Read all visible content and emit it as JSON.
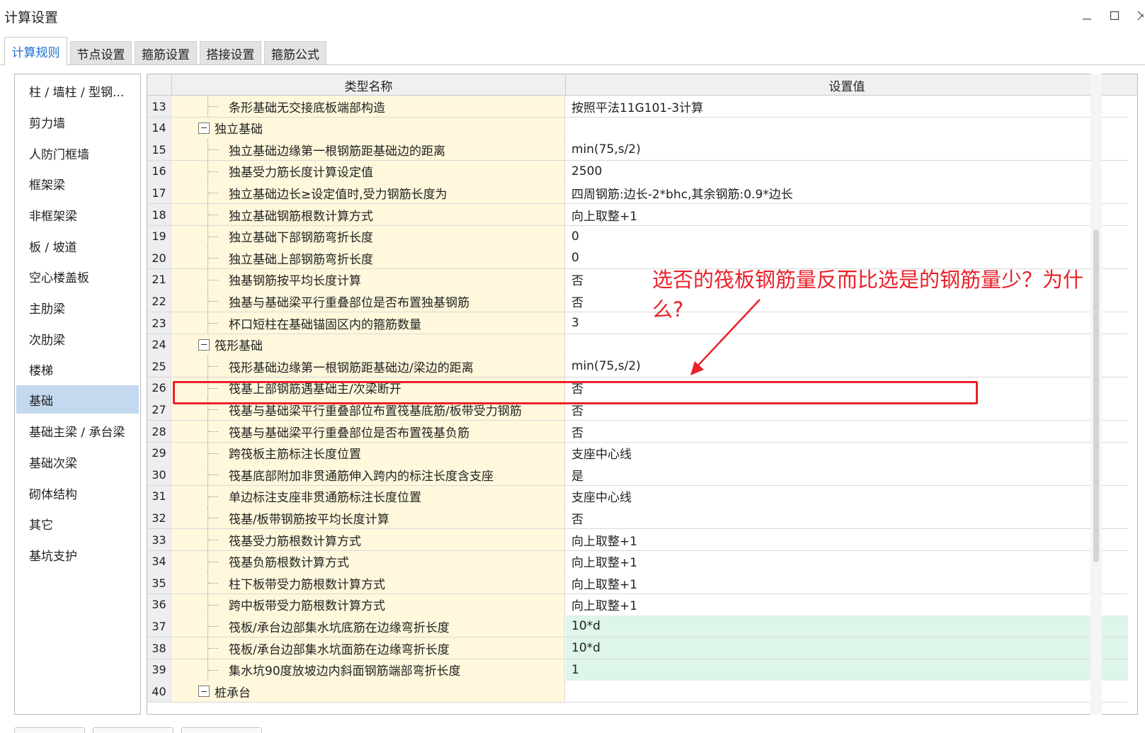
{
  "window": {
    "title": "计算设置",
    "minimize": "—",
    "maximize": "☐",
    "close": "›"
  },
  "tabs": [
    {
      "label": "计算规则",
      "active": true
    },
    {
      "label": "节点设置",
      "active": false
    },
    {
      "label": "箍筋设置",
      "active": false
    },
    {
      "label": "搭接设置",
      "active": false
    },
    {
      "label": "箍筋公式",
      "active": false
    }
  ],
  "sidebar": {
    "items": [
      {
        "label": "柱 / 墙柱 / 型钢..."
      },
      {
        "label": "剪力墙"
      },
      {
        "label": "人防门框墙"
      },
      {
        "label": "框架梁"
      },
      {
        "label": "非框架梁"
      },
      {
        "label": "板 / 坡道"
      },
      {
        "label": "空心楼盖板"
      },
      {
        "label": "主肋梁"
      },
      {
        "label": "次肋梁"
      },
      {
        "label": "楼梯"
      },
      {
        "label": "基础",
        "selected": true
      },
      {
        "label": "基础主梁 / 承台梁"
      },
      {
        "label": "基础次梁"
      },
      {
        "label": "砌体结构"
      },
      {
        "label": "其它"
      },
      {
        "label": "基坑支护"
      }
    ]
  },
  "grid": {
    "headers": {
      "name": "类型名称",
      "value": "设置值"
    },
    "rows": [
      {
        "num": "13",
        "name": "条形基础无交接底板端部构造",
        "value": "按照平法11G101-3计算"
      },
      {
        "num": "14",
        "name": "独立基础",
        "value": "",
        "group": true
      },
      {
        "num": "15",
        "name": "独立基础边缘第一根钢筋距基础边的距离",
        "value": "min(75,s/2)"
      },
      {
        "num": "16",
        "name": "独基受力筋长度计算设定值",
        "value": "2500"
      },
      {
        "num": "17",
        "name": "独立基础边长≥设定值时,受力钢筋长度为",
        "value": "四周钢筋:边长-2*bhc,其余钢筋:0.9*边长"
      },
      {
        "num": "18",
        "name": "独立基础钢筋根数计算方式",
        "value": "向上取整+1"
      },
      {
        "num": "19",
        "name": "独立基础下部钢筋弯折长度",
        "value": "0"
      },
      {
        "num": "20",
        "name": "独立基础上部钢筋弯折长度",
        "value": "0"
      },
      {
        "num": "21",
        "name": "独基钢筋按平均长度计算",
        "value": "否"
      },
      {
        "num": "22",
        "name": "独基与基础梁平行重叠部位是否布置独基钢筋",
        "value": "否"
      },
      {
        "num": "23",
        "name": "杯口短柱在基础锚固区内的箍筋数量",
        "value": "3"
      },
      {
        "num": "24",
        "name": "筏形基础",
        "value": "",
        "group": true
      },
      {
        "num": "25",
        "name": "筏形基础边缘第一根钢筋距基础边/梁边的距离",
        "value": "min(75,s/2)"
      },
      {
        "num": "26",
        "name": "筏基上部钢筋遇基础主/次梁断开",
        "value": "否"
      },
      {
        "num": "27",
        "name": "筏基与基础梁平行重叠部位布置筏基底筋/板带受力钢筋",
        "value": "否"
      },
      {
        "num": "28",
        "name": "筏基与基础梁平行重叠部位是否布置筏基负筋",
        "value": "否"
      },
      {
        "num": "29",
        "name": "跨筏板主筋标注长度位置",
        "value": "支座中心线"
      },
      {
        "num": "30",
        "name": "筏基底部附加非贯通筋伸入跨内的标注长度含支座",
        "value": "是"
      },
      {
        "num": "31",
        "name": "单边标注支座非贯通筋标注长度位置",
        "value": "支座中心线"
      },
      {
        "num": "32",
        "name": "筏基/板带钢筋按平均长度计算",
        "value": "否"
      },
      {
        "num": "33",
        "name": "筏基受力筋根数计算方式",
        "value": "向上取整+1"
      },
      {
        "num": "34",
        "name": "筏基负筋根数计算方式",
        "value": "向上取整+1"
      },
      {
        "num": "35",
        "name": "柱下板带受力筋根数计算方式",
        "value": "向上取整+1"
      },
      {
        "num": "36",
        "name": "跨中板带受力筋根数计算方式",
        "value": "向上取整+1"
      },
      {
        "num": "37",
        "name": "筏板/承台边部集水坑底筋在边缘弯折长度",
        "value": "10*d",
        "green": true
      },
      {
        "num": "38",
        "name": "筏板/承台边部集水坑面筋在边缘弯折长度",
        "value": "10*d",
        "green": true
      },
      {
        "num": "39",
        "name": "集水坑90度放坡边内斜面钢筋端部弯折长度",
        "value": "1",
        "green": true
      },
      {
        "num": "40",
        "name": "桩承台",
        "value": "",
        "group": true
      }
    ]
  },
  "annotation": {
    "text": "选否的筏板钢筋量反而比选是的钢筋量少？为什么?",
    "color": "#e8222a"
  },
  "colors": {
    "accent_blue": "#1a6fd0",
    "selected_bg": "#c4d9f0",
    "name_col_bg": "#fff8dc",
    "green_value_bg": "#def5ea",
    "annotation_red": "#e8222a"
  }
}
